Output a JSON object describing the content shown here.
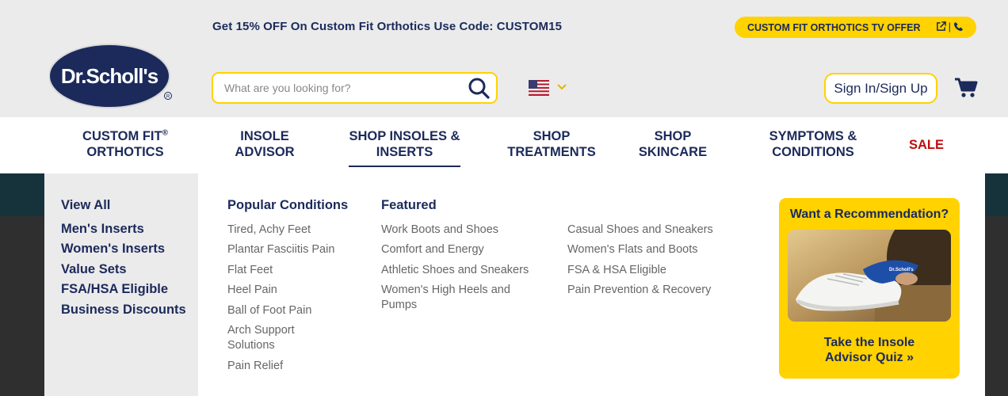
{
  "promo_text": "Get 15% OFF On Custom Fit Orthotics Use Code: CUSTOM15",
  "tv_offer_label": "CUSTOM FIT ORTHOTICS TV OFFER",
  "logo_text": "Dr.Scholl's",
  "search": {
    "placeholder": "What are you looking for?",
    "value": ""
  },
  "signin_label": "Sign In/Sign Up",
  "nav": {
    "custom_fit_line1": "CUSTOM FIT",
    "custom_fit_sup": "®",
    "custom_fit_line2": "ORTHOTICS",
    "insole_line1": "INSOLE",
    "insole_line2": "ADVISOR",
    "shop_insoles_line1": "SHOP INSOLES &",
    "shop_insoles_line2": "INSERTS",
    "treatments_line1": "SHOP",
    "treatments_line2": "TREATMENTS",
    "skincare_line1": "SHOP",
    "skincare_line2": "SKINCARE",
    "symptoms_line1": "SYMPTOMS &",
    "symptoms_line2": "CONDITIONS",
    "sale": "SALE"
  },
  "menu_left": [
    "View All",
    "Men's Inserts",
    "Women's Inserts",
    "Value Sets",
    "FSA/HSA Eligible",
    "Business Discounts"
  ],
  "popular_conditions": {
    "heading": "Popular Conditions",
    "items": [
      "Tired, Achy Feet",
      "Plantar Fasciitis Pain",
      "Flat Feet",
      "Heel Pain",
      "Ball of Foot Pain",
      "Arch Support",
      "Solutions",
      "Pain Relief"
    ]
  },
  "featured": {
    "heading": "Featured",
    "col1": [
      "Work Boots and Shoes",
      "Comfort and Energy",
      "Athletic Shoes and Sneakers",
      "Women's High Heels and",
      "Pumps"
    ],
    "col2": [
      "Casual Shoes and Sneakers",
      "Women's Flats and Boots",
      "FSA & HSA Eligible",
      "Pain Prevention & Recovery"
    ]
  },
  "recommendation": {
    "title": "Want a Recommendation?",
    "cta_line1": "Take the Insole",
    "cta_line2": "Advisor Quiz »"
  },
  "colors": {
    "navy": "#1b2a5b",
    "yellow": "#ffd200",
    "sale_red": "#c00d0d",
    "gray_bg": "#ebebeb"
  }
}
